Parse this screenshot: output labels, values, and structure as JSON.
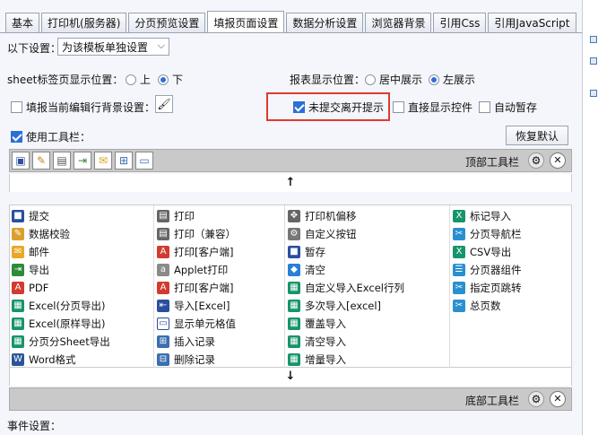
{
  "tabs": [
    "基本",
    "打印机(服务器)",
    "分页预览设置",
    "填报页面设置",
    "数据分析设置",
    "浏览器背景",
    "引用Css",
    "引用JavaScript"
  ],
  "active_tab": "填报页面设置",
  "settings": {
    "scope_label": "以下设置：",
    "scope_value": "为该模板单独设置",
    "sheet_pos_label": "sheet标签页显示位置：",
    "sheet_pos_top": "上",
    "sheet_pos_bottom": "下",
    "report_pos_label": "报表显示位置：",
    "report_pos_center": "居中展示",
    "report_pos_left": "左展示",
    "fill_bg_label": "填报当前编辑行背景设置：",
    "unsubmitted_label": "未提交离开提示",
    "show_ctrl_label": "直接显示控件",
    "autosave_label": "自动暂存",
    "use_toolbar_label": "使用工具栏：",
    "restore_label": "恢复默认"
  },
  "top_toolbar_label": "顶部工具栏",
  "bottom_toolbar_label": "底部工具栏",
  "arrow_up": "↑",
  "arrow_down": "↓",
  "event_label": "事件设置：",
  "items": {
    "col1": [
      {
        "icon": "save-icon",
        "label": "提交"
      },
      {
        "icon": "verify-icon",
        "label": "数据校验"
      },
      {
        "icon": "mail-icon",
        "label": "邮件"
      },
      {
        "icon": "export-icon",
        "label": "导出"
      },
      {
        "icon": "pdf-icon",
        "label": "PDF"
      },
      {
        "icon": "excel-icon",
        "label": "Excel(分页导出)"
      },
      {
        "icon": "excel-icon",
        "label": "Excel(原样导出)"
      },
      {
        "icon": "excel-icon",
        "label": "分页分Sheet导出"
      },
      {
        "icon": "word-icon",
        "label": "Word格式"
      }
    ],
    "col2": [
      {
        "icon": "print-icon",
        "label": "打印"
      },
      {
        "icon": "print-icon",
        "label": "打印（兼容）"
      },
      {
        "icon": "pdf-print-icon",
        "label": "打印[客户端]"
      },
      {
        "icon": "applet-icon",
        "label": "Applet打印"
      },
      {
        "icon": "pdf-print-icon",
        "label": "打印[客户端]"
      },
      {
        "icon": "import-excel-icon",
        "label": "导入[Excel]"
      },
      {
        "icon": "cell-icon",
        "label": "显示单元格值"
      },
      {
        "icon": "insert-row-icon",
        "label": "插入记录"
      },
      {
        "icon": "delete-row-icon",
        "label": "删除记录"
      }
    ],
    "col3": [
      {
        "icon": "move-icon",
        "label": "打印机偏移"
      },
      {
        "icon": "gear-icon",
        "label": "自定义按钮"
      },
      {
        "icon": "save-icon",
        "label": "暂存"
      },
      {
        "icon": "eraser-icon",
        "label": "清空"
      },
      {
        "icon": "excel-icon",
        "label": "自定义导入Excel行列"
      },
      {
        "icon": "excel-icon",
        "label": "多次导入[excel]"
      },
      {
        "icon": "excel-icon",
        "label": "覆盖导入"
      },
      {
        "icon": "excel-icon",
        "label": "清空导入"
      },
      {
        "icon": "excel-icon",
        "label": "增量导入"
      }
    ],
    "col4": [
      {
        "icon": "mark-import-icon",
        "label": "标记导入"
      },
      {
        "icon": "nav-icon",
        "label": "分页导航栏"
      },
      {
        "icon": "csv-icon",
        "label": "CSV导出"
      },
      {
        "icon": "pager-icon",
        "label": "分页器组件"
      },
      {
        "icon": "nav-icon",
        "label": "指定页跳转"
      },
      {
        "icon": "nav-icon",
        "label": "总页数"
      }
    ]
  }
}
